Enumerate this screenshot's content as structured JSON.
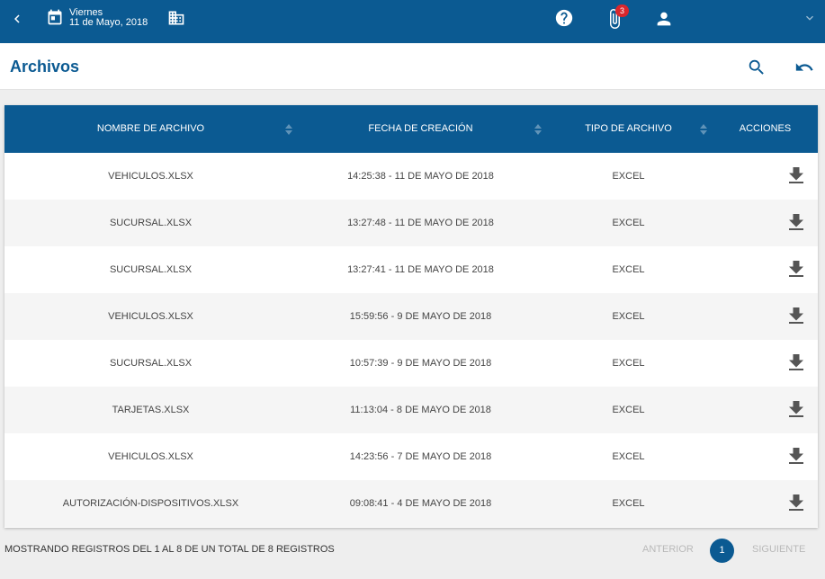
{
  "topbar": {
    "day": "Viernes",
    "date": "11 de Mayo, 2018",
    "notifications_count": "3",
    "icons": [
      "back-arrow-icon",
      "calendar-icon",
      "building-icon",
      "help-icon",
      "paperclip-icon",
      "user-icon",
      "chevron-down-icon"
    ]
  },
  "header": {
    "title": "Archivos",
    "icons": [
      "search-icon",
      "undo-icon"
    ]
  },
  "table": {
    "columns": [
      "NOMBRE DE ARCHIVO",
      "FECHA DE CREACIÓN",
      "TIPO DE ARCHIVO",
      "ACCIONES"
    ],
    "rows": [
      {
        "name": "VEHICULOS.XLSX",
        "created": "14:25:38 - 11 DE MAYO DE 2018",
        "type": "EXCEL"
      },
      {
        "name": "SUCURSAL.XLSX",
        "created": "13:27:48 - 11 DE MAYO DE 2018",
        "type": "EXCEL"
      },
      {
        "name": "SUCURSAL.XLSX",
        "created": "13:27:41 - 11 DE MAYO DE 2018",
        "type": "EXCEL"
      },
      {
        "name": "VEHICULOS.XLSX",
        "created": "15:59:56 - 9 DE MAYO DE 2018",
        "type": "EXCEL"
      },
      {
        "name": "SUCURSAL.XLSX",
        "created": "10:57:39 - 9 DE MAYO DE 2018",
        "type": "EXCEL"
      },
      {
        "name": "TARJETAS.XLSX",
        "created": "11:13:04 - 8 DE MAYO DE 2018",
        "type": "EXCEL"
      },
      {
        "name": "VEHICULOS.XLSX",
        "created": "14:23:56 - 7 DE MAYO DE 2018",
        "type": "EXCEL"
      },
      {
        "name": "AUTORIZACIÓN-DISPOSITIVOS.XLSX",
        "created": "09:08:41 - 4 DE MAYO DE 2018",
        "type": "EXCEL"
      }
    ],
    "row_action_icon": "download-icon"
  },
  "footer": {
    "summary": "MOSTRANDO REGISTROS DEL 1 AL 8 DE UN TOTAL DE 8 REGISTROS",
    "prev_label": "ANTERIOR",
    "current_page": "1",
    "next_label": "SIGUIENTE"
  },
  "colors": {
    "primary": "#0b5a92",
    "badge": "#d9262c",
    "row_alt": "#f5f5f5"
  }
}
